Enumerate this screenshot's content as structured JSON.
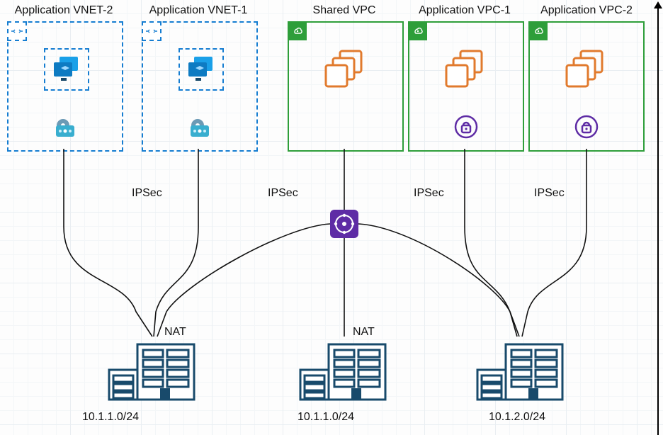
{
  "labels": {
    "vnet2": "Application VNET-2",
    "vnet1": "Application VNET-1",
    "sharedVpc": "Shared VPC",
    "appVpc1": "Application VPC-1",
    "appVpc2": "Application VPC-2",
    "ipsec1": "IPSec",
    "ipsec2": "IPSec",
    "ipsec3": "IPSec",
    "ipsec4": "IPSec",
    "nat1": "NAT",
    "nat2": "NAT",
    "cidr1": "10.1.1.0/24",
    "cidr2": "10.1.1.0/24",
    "cidr3": "10.1.2.0/24"
  },
  "colors": {
    "azure": "#157dd1",
    "aws_green": "#2e9e3a",
    "aws_orange": "#e17a2d",
    "aws_purple": "#5e2ca5",
    "steel": "#184a6b"
  }
}
